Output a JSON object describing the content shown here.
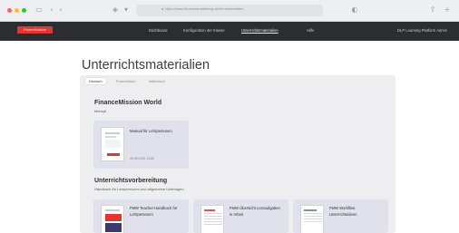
{
  "browser": {
    "url": "● https://www.financeausbildung.de/lernmaterialien",
    "colors": {
      "close": "#ff5f57",
      "minimize": "#febc2e",
      "maximize": "#28c840"
    },
    "icons": [
      "sidebar-icon",
      "back-icon",
      "forward-icon",
      "shield-icon",
      "reload-icon",
      "share-icon",
      "add-tab-icon"
    ]
  },
  "nav": {
    "brand": "FinanceMission",
    "items": [
      "Dashboard",
      "Konfiguration der Klasse",
      "Unterrichtsmaterialien",
      "Hilfe",
      "DLP Learning Platform Admin"
    ],
    "active_index": 2
  },
  "page": {
    "title": "Unterrichtsmaterialien",
    "tabs": [
      "Deutsch",
      "Französisch",
      "Italienisch"
    ],
    "active_tab": 0
  },
  "sections": [
    {
      "title": "FinanceMission World",
      "subtitle": "Manual",
      "cards": [
        {
          "title": "Manual für Lehrpersonen",
          "date": "25.05.2023, 11:50"
        }
      ]
    },
    {
      "title": "Unterrichtsvorbereitung",
      "subtitle": "Handbuch für Lehrpersonen und allgemeine Unterlagen",
      "cards": [
        {
          "title": "FMW Teacher Handbuch für Lehrpersonen"
        },
        {
          "title": "FMW Übersicht Lernaufgaben in Arbeit"
        },
        {
          "title": "FMW Workflow Unterrichtsideen"
        }
      ]
    }
  ],
  "accent": "#e2362f"
}
